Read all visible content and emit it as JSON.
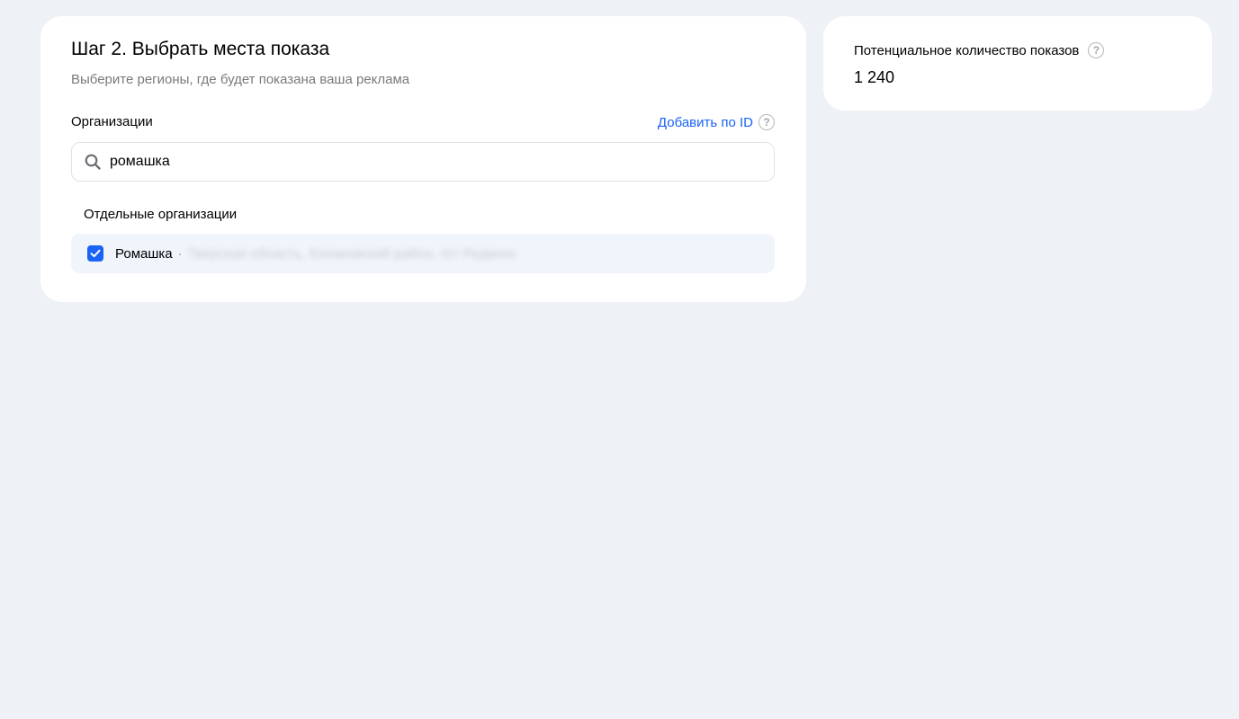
{
  "step": {
    "title": "Шаг 2. Выбрать места показа",
    "subtitle": "Выберите регионы, где будет показана ваша реклама"
  },
  "organizations": {
    "label": "Организации",
    "add_by_id_label": "Добавить по ID",
    "help_glyph": "?",
    "search": {
      "value": "ромашка",
      "icon": "search-icon"
    },
    "group_title": "Отдельные организации",
    "items": [
      {
        "name": "Ромашка",
        "separator": "·",
        "address": "Тверская область, Конаковский район, пгт Редкино",
        "checked": true
      }
    ]
  },
  "impressions": {
    "label": "Потенциальное количество показов",
    "value": "1 240",
    "help_glyph": "?"
  },
  "colors": {
    "background": "#eef1f5",
    "accent": "#1a63f5",
    "row_bg": "#f0f4fb"
  }
}
